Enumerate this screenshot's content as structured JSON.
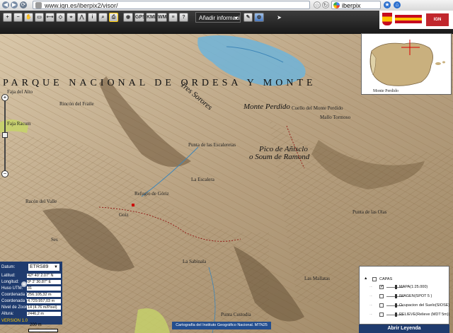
{
  "browser": {
    "url": "www.ign.es/iberpix2/visor/",
    "search_text": "iberpix"
  },
  "toolbar": {
    "add_info_label": "Añadir información",
    "buttons": [
      "zoom-in",
      "zoom-out",
      "pan",
      "zoom-box",
      "measure-distance",
      "measure-area",
      "coordinates",
      "profile",
      "info",
      "search",
      "print",
      "gps",
      "kml",
      "help"
    ]
  },
  "map": {
    "park_title": "PARQUE NACIONAL DE ORDESA Y MONTE",
    "places": [
      {
        "text": "Monte Perdido",
        "cls": "big"
      },
      {
        "text": "Cuello del Monte Perdido",
        "cls": "small"
      },
      {
        "text": "Punta de las Escaleretas",
        "cls": "small"
      },
      {
        "text": "Pico de Añisclo",
        "cls": "big"
      },
      {
        "text": "o Soum de Ramond",
        "cls": "big"
      },
      {
        "text": "Racón del Valle",
        "cls": "small"
      },
      {
        "text": "Rincón del Fraile",
        "cls": "small"
      },
      {
        "text": "Faja del Alto",
        "cls": "small"
      },
      {
        "text": "Faja Racum",
        "cls": "small"
      },
      {
        "text": "La Escalera",
        "cls": "small"
      },
      {
        "text": "Punta de las Olas",
        "cls": "small"
      },
      {
        "text": "Punta Custodia",
        "cls": "small"
      },
      {
        "text": "La Sabinala",
        "cls": "small"
      },
      {
        "text": "Tres Sorores",
        "cls": "big"
      },
      {
        "text": "Ses",
        "cls": "small"
      },
      {
        "text": "Goiz",
        "cls": "small"
      },
      {
        "text": "Las Mallatas",
        "cls": "small"
      },
      {
        "text": "Mallo Tormoso",
        "cls": "small"
      },
      {
        "text": "Refugio de Góriz",
        "cls": "small"
      }
    ]
  },
  "coordinates": {
    "datum_label": "Datum:",
    "datum_value": "ETRS89",
    "rows": [
      {
        "label": "Latitud:",
        "value": "42º 40' 2.07\" N"
      },
      {
        "label": "Longitud:",
        "value": "0º 2' 30.87\" E"
      },
      {
        "label": "Huso UTM:",
        "value": "31"
      },
      {
        "label": "Coordenada X:",
        "value": "256.105,32 m"
      },
      {
        "label": "Coordenada Y:",
        "value": "4.729.957,03 m"
      },
      {
        "label": "Nivel de Zoom:",
        "value": "14 (4.76 m/Pixel)"
      },
      {
        "label": "Altura:",
        "value": "2446,2 m"
      }
    ],
    "version": "VERSION 1.0"
  },
  "scale": {
    "text": "200 m"
  },
  "attribution": "Cartografía del Instituto Geográfico Nacional. MTN25",
  "overview": {
    "caption": "Monte Perdido"
  },
  "layers": {
    "root": "CAPAS",
    "items": [
      {
        "label": "MAPA(1:25.000)",
        "checked": true
      },
      {
        "label": "IMAGEN(SPOT 5 )",
        "checked": false
      },
      {
        "label": "Ocupacion del Suelo(SIOSE)",
        "checked": false
      },
      {
        "label": "RELIEVE(Relieve (MDT 5m))",
        "checked": false
      }
    ],
    "open_legend": "Abrir Leyenda"
  },
  "colors": {
    "panel_blue": "#1f3b6e",
    "terrain": "#b9a486",
    "lake": "#6fb4d9",
    "contour": "#8a6a3f"
  }
}
